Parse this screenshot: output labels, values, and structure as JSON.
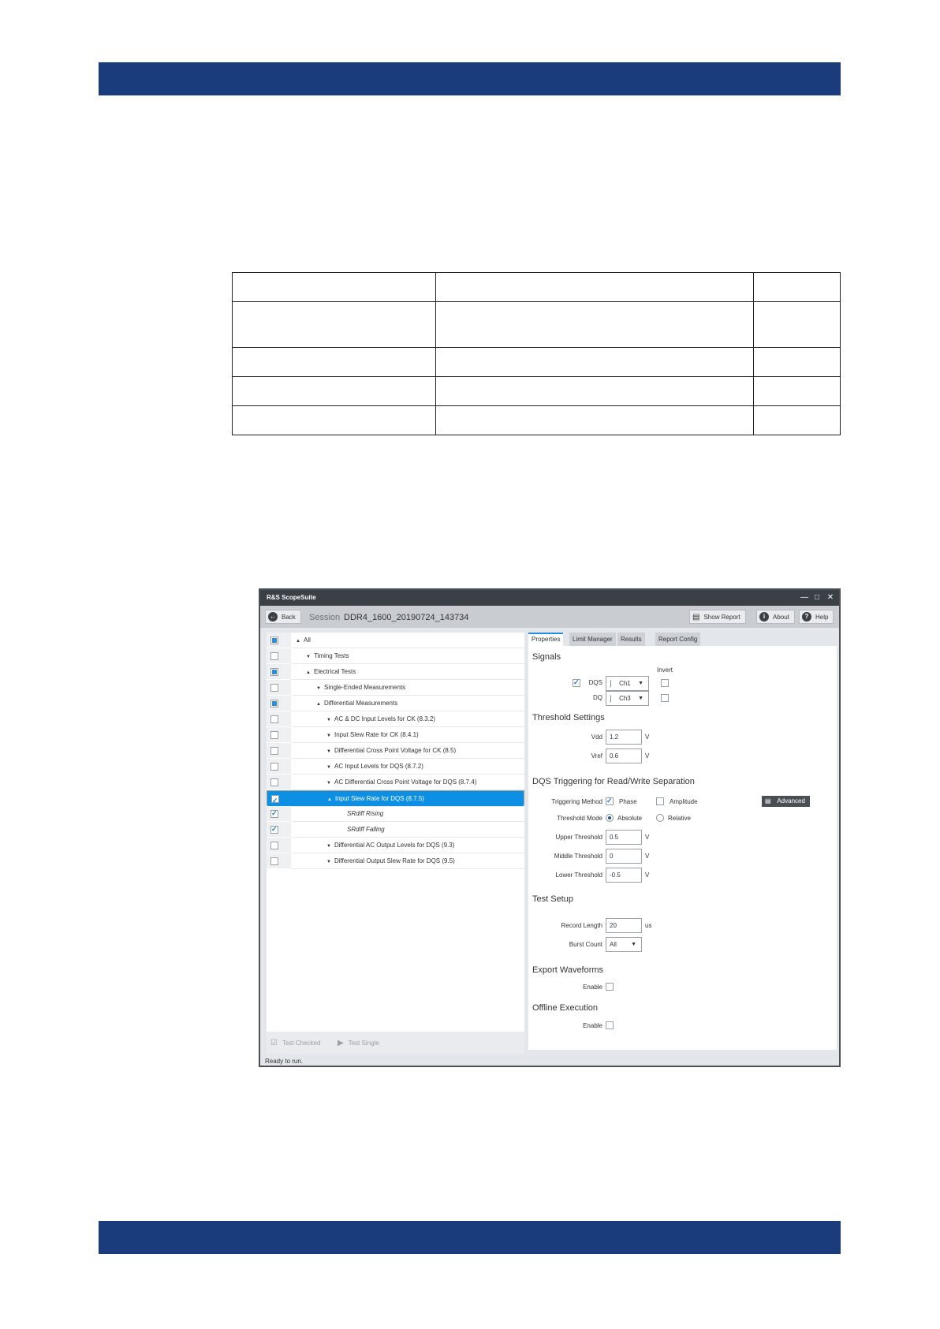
{
  "page": {
    "doc_table_rows": [
      [
        "",
        "",
        ""
      ],
      [
        "",
        "",
        ""
      ],
      [
        "",
        "",
        ""
      ],
      [
        "",
        "",
        ""
      ],
      [
        "",
        "",
        ""
      ]
    ]
  },
  "app": {
    "window_title": "R&S ScopeSuite",
    "toolbar": {
      "back_label": "Back",
      "session_label": "Session",
      "session_name": "DDR4_1600_20190724_143734",
      "show_report_label": "Show Report",
      "about_label": "About",
      "help_label": "Help"
    },
    "tree": [
      {
        "label": "All",
        "state": "partial",
        "arrow": "up"
      },
      {
        "label": "Timing Tests",
        "state": "unchecked",
        "arrow": "down"
      },
      {
        "label": "Electrical Tests",
        "state": "partial",
        "arrow": "up"
      },
      {
        "label": "Single-Ended Measurements",
        "state": "unchecked",
        "arrow": "down"
      },
      {
        "label": "Differential Measurements",
        "state": "partial",
        "arrow": "up"
      },
      {
        "label": "AC & DC Input Levels for CK (8.3.2)",
        "state": "unchecked",
        "arrow": "down"
      },
      {
        "label": "Input Slew Rate for CK (8.4.1)",
        "state": "unchecked",
        "arrow": "down"
      },
      {
        "label": "Differential Cross Point Voltage for CK (8.5)",
        "state": "unchecked",
        "arrow": "down"
      },
      {
        "label": "AC Input Levels for DQS (8.7.2)",
        "state": "unchecked",
        "arrow": "down"
      },
      {
        "label": "AC Differential Cross Point Voltage for DQS (8.7.4)",
        "state": "unchecked",
        "arrow": "down"
      },
      {
        "label": "Input Slew Rate for DQS (8.7.5)",
        "state": "checked",
        "arrow": "up",
        "selected": true
      },
      {
        "label": "SRdiff Rising",
        "state": "checked",
        "arrow": "",
        "italic": true
      },
      {
        "label": "SRdiff Falling",
        "state": "checked",
        "arrow": "",
        "italic": true
      },
      {
        "label": "Differential AC Output Levels for DQS (9.3)",
        "state": "unchecked",
        "arrow": "down"
      },
      {
        "label": "Differential Output Slew Rate for DQS (9.5)",
        "state": "unchecked",
        "arrow": "down"
      }
    ],
    "footer": {
      "test_checked_label": "Test Checked",
      "test_single_label": "Test Single"
    },
    "status": "Ready to run.",
    "tabs": [
      "Properties",
      "Limit Manager",
      "Results",
      "Report Config"
    ],
    "properties": {
      "signals_title": "Signals",
      "invert_label": "Invert",
      "dqs_label": "DQS",
      "dqs_channel": "Ch1",
      "dq_label": "DQ",
      "dq_channel": "Ch3",
      "threshold_title": "Threshold Settings",
      "vdd_label": "Vdd",
      "vdd_value": "1.2",
      "vref_label": "Vref",
      "vref_value": "0.6",
      "volt_unit": "V",
      "dqs_trig_title": "DQS Triggering for Read/Write Separation",
      "trig_method_label": "Triggering Method",
      "phase_label": "Phase",
      "amplitude_label": "Amplitude",
      "advanced_label": "Advanced",
      "threshold_mode_label": "Threshold Mode",
      "absolute_label": "Absolute",
      "relative_label": "Relative",
      "upper_label": "Upper Threshold",
      "upper_value": "0.5",
      "middle_label": "Middle Threshold",
      "middle_value": "0",
      "lower_label": "Lower Threshold",
      "lower_value": "-0.5",
      "test_setup_title": "Test Setup",
      "record_length_label": "Record Length",
      "record_length_value": "20",
      "record_length_unit": "us",
      "burst_count_label": "Burst Count",
      "burst_count_value": "All",
      "export_title": "Export Waveforms",
      "enable_label": "Enable",
      "offline_title": "Offline Execution"
    }
  },
  "colors": {
    "band": "#1b3c7c",
    "selection": "#0d8fe3",
    "accent": "#2a8de0"
  }
}
